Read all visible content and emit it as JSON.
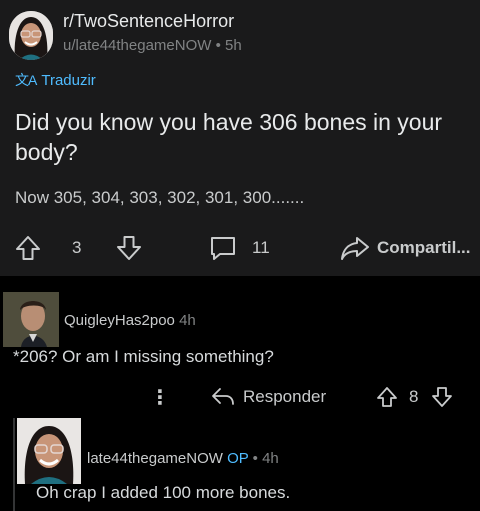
{
  "post": {
    "subreddit": "r/TwoSentenceHorror",
    "author": "u/late44thegameNOW",
    "age": "5h",
    "translate_label": "Traduzir",
    "title": "Did you know you have 306 bones in your body?",
    "body": "Now 305, 304, 303, 302, 301, 300.......",
    "vote_count": "3",
    "comment_count": "11",
    "share_label": "Compartil..."
  },
  "comment": {
    "author": "QuigleyHas2poo",
    "age": "4h",
    "text": "*206? Or am I missing something?",
    "more_label": "⋮",
    "reply_label": "Responder",
    "vote_count": "8"
  },
  "reply": {
    "author": "late44thegameNOW",
    "op_badge": "OP",
    "age": "4h",
    "text": "Oh crap I added 100 more bones."
  },
  "colors": {
    "card_bg": "#1a1a1b",
    "page_bg": "#000000",
    "link_blue": "#4fbcff",
    "meta_gray": "#818384"
  },
  "icons": {
    "translate": "translate-icon",
    "upvote": "arrow-up-icon",
    "downvote": "arrow-down-icon",
    "comment": "speech-bubble-icon",
    "share": "share-arrow-icon",
    "reply": "reply-arrow-icon",
    "more": "kebab-menu-icon"
  }
}
